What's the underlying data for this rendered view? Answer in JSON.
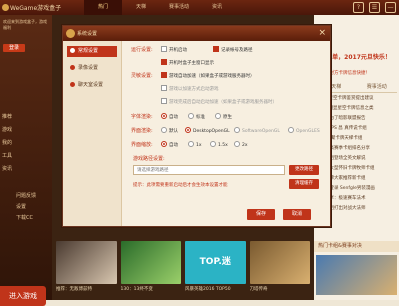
{
  "app": {
    "title": "WeGame游戏盒子",
    "nav": [
      {
        "label": "热门",
        "active": true
      },
      {
        "label": "天梯",
        "active": false
      },
      {
        "label": "赛事活动",
        "active": false
      },
      {
        "label": "资讯",
        "active": false
      }
    ],
    "window_buttons": [
      "?",
      "☰",
      "—"
    ]
  },
  "sidebar": {
    "user_text": "欢迎来到游戏盒子，游戏福利",
    "login_label": "登录",
    "items": [
      "推荐",
      "游戏",
      "我的",
      "工具",
      "资讯"
    ],
    "subitems": [
      "问题反馈",
      "设置",
      "下载CC"
    ],
    "enter_label": "进入游戏"
  },
  "thumbs": [
    {
      "caption": "推荐：无敌博兹特",
      "overlay": "战士的顶级翻盘"
    },
    {
      "caption": "130：13终不变",
      "overlay": ""
    },
    {
      "caption": "风暴英雄2016 TOP50",
      "overlay": "TOP.迷"
    },
    {
      "caption": "刀塔传奇",
      "overlay": ""
    }
  ],
  "right_panel": {
    "title": "7周年单，2017元旦快乐！",
    "subtitle": "：显示对方卡牌信息快捷！",
    "tabs": [
      "天梯",
      "赛事活动"
    ],
    "items": [
      "[评论]星空卡牌鉴赏提出建议",
      "[资讯]明显星空卡牌信息之类",
      "新英雄为了暗影联盟报告",
      "炉石TOPS 昌 真传说卡组",
      "新英雄 聚卡牌天梯卡组",
      "天梯最高赛季卡组排名分享",
      "全新卡组登场全英文解说",
      "卡组：大型怀旧卡牌牧师卡组",
      "法师卡牌大家推荐新卡组",
      "新卡组登录 Senfgle男装漫画",
      "卡组分享：极速赛车法术",
      "法师卡组打出对战大法师"
    ],
    "hot_label": "热门卡组&赛事对决"
  },
  "dialog": {
    "title": "系统设置",
    "close_label": "×",
    "nav": [
      {
        "label": "常规设置",
        "active": true
      },
      {
        "label": "录像设置",
        "active": false
      },
      {
        "label": "聊天室设置",
        "active": false
      }
    ],
    "sections": {
      "general_label": "运行设置:",
      "general_opts": [
        "开机启动",
        "记录帐号及路径",
        "开机时盒子主窗口显示"
      ],
      "perf_label": "灵敏设置:",
      "perf_opts": [
        "游戏自动加速（如果盒子或游戏服务器时）",
        "游戏以加速方式启动游戏",
        "游戏完成后自动启动加速（如果盒子或游戏服务器时）"
      ],
      "font_label": "字体渲染:",
      "font_opts": [
        "自动",
        "标准",
        "原生"
      ],
      "render_label": "界面渲染:",
      "render_opts": [
        "默认",
        "DesktopOpenGL",
        "SoftwareOpenGL",
        "OpenGLES"
      ],
      "scale_label": "界面缩放:",
      "scale_opts": [
        "自动",
        "1x",
        "1.5x",
        "2x"
      ],
      "path_label": "游戏路径设置:",
      "path_value": "",
      "path_placeholder": "请选择游戏路径",
      "change_label": "更改路径",
      "scan_label": "清理缓存",
      "hint": "提示：此项需要重新启动后才会生效本设置才能",
      "save_label": "保存",
      "cancel_label": "取消"
    }
  },
  "colors": {
    "accent": "#c0341a",
    "header": "#5a1e0a",
    "dialog_bg": "#f7efe0"
  }
}
